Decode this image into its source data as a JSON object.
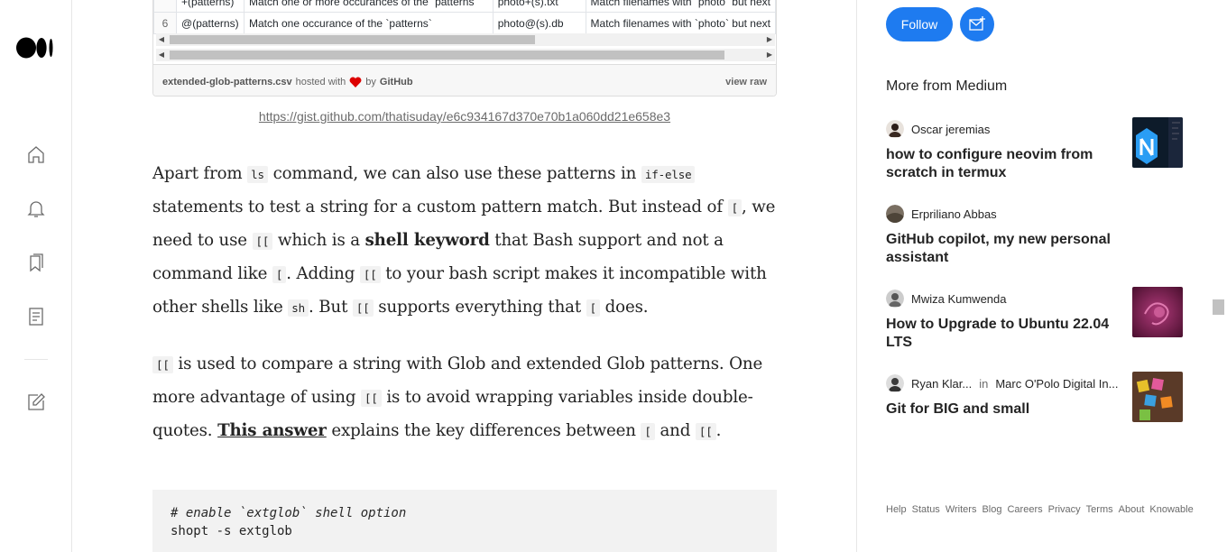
{
  "gist": {
    "rows": [
      {
        "line": "",
        "pattern": "+(patterns)",
        "desc": "Match one or more occurances of the `patterns`",
        "example": "photo+(s).txt",
        "note": "Match filenames with `photo` but next"
      },
      {
        "line": "6",
        "pattern": "@(patterns)",
        "desc": "Match one occurance of the `patterns`",
        "example": "photo@(s).db",
        "note": "Match filenames with `photo` but next"
      }
    ],
    "filename": "extended-glob-patterns.csv",
    "hosted_with": "hosted with",
    "by": "by",
    "host": "GitHub",
    "view_raw": "view raw",
    "link": "https://gist.github.com/thatisuday/e6c934167d370e70b1a060dd21e658e3"
  },
  "para1": {
    "t1": "Apart from ",
    "c1": "ls",
    "t2": " command, we can also use these patterns in ",
    "c2": "if-else",
    "t3": " statements to test a string for a custom pattern match. But instead of ",
    "c3": "[",
    "t4": ", we need to use ",
    "c4": "[[",
    "t5": " which is a ",
    "b1": "shell keyword",
    "t6": " that Bash support and not a command like ",
    "c5": "[",
    "t7": ". Adding ",
    "c6": "[[",
    "t8": " to your bash script makes it incompatible with other shells like ",
    "c7": "sh",
    "t9": ". But ",
    "c8": "[[",
    "t10": " supports everything that ",
    "c9": "[",
    "t11": " does."
  },
  "para2": {
    "c1": "[[",
    "t1": " is used to compare a string with Glob and extended Glob patterns. One more advantage of using ",
    "c2": "[[",
    "t2": " is to avoid wrapping variables inside double-quotes. ",
    "link": "This answer",
    "t3": " explains the key differences between ",
    "c3": "[",
    "t4": " and ",
    "c4": "[[",
    "t5": "."
  },
  "code": {
    "comment": "# enable `extglob` shell option",
    "line": "shopt -s extglob"
  },
  "sidebar": {
    "follow_label": "Follow",
    "more_title": "More from Medium",
    "recs": [
      {
        "author": "Oscar jeremias",
        "publication": "",
        "title": "how to configure neovim from scratch in termux"
      },
      {
        "author": "Erpriliano Abbas",
        "publication": "",
        "title": "GitHub copilot, my new personal assistant"
      },
      {
        "author": "Mwiza Kumwenda",
        "publication": "",
        "title": "How to Upgrade to Ubuntu 22.04 LTS"
      },
      {
        "author": "Ryan Klar...",
        "in": "in",
        "publication": "Marc O'Polo Digital In...",
        "title": "Git for BIG and small"
      }
    ],
    "footer_links": [
      "Help",
      "Status",
      "Writers",
      "Blog",
      "Careers",
      "Privacy",
      "Terms",
      "About",
      "Knowable"
    ]
  },
  "colors": {
    "accent": "#1e7bf0",
    "text": "#242424",
    "muted": "#6b6b6b"
  },
  "icons": [
    "medium-logo-icon",
    "home-icon",
    "bell-icon",
    "bookmarks-icon",
    "stories-icon",
    "write-icon",
    "heart-icon",
    "subscribe-mail-icon"
  ]
}
